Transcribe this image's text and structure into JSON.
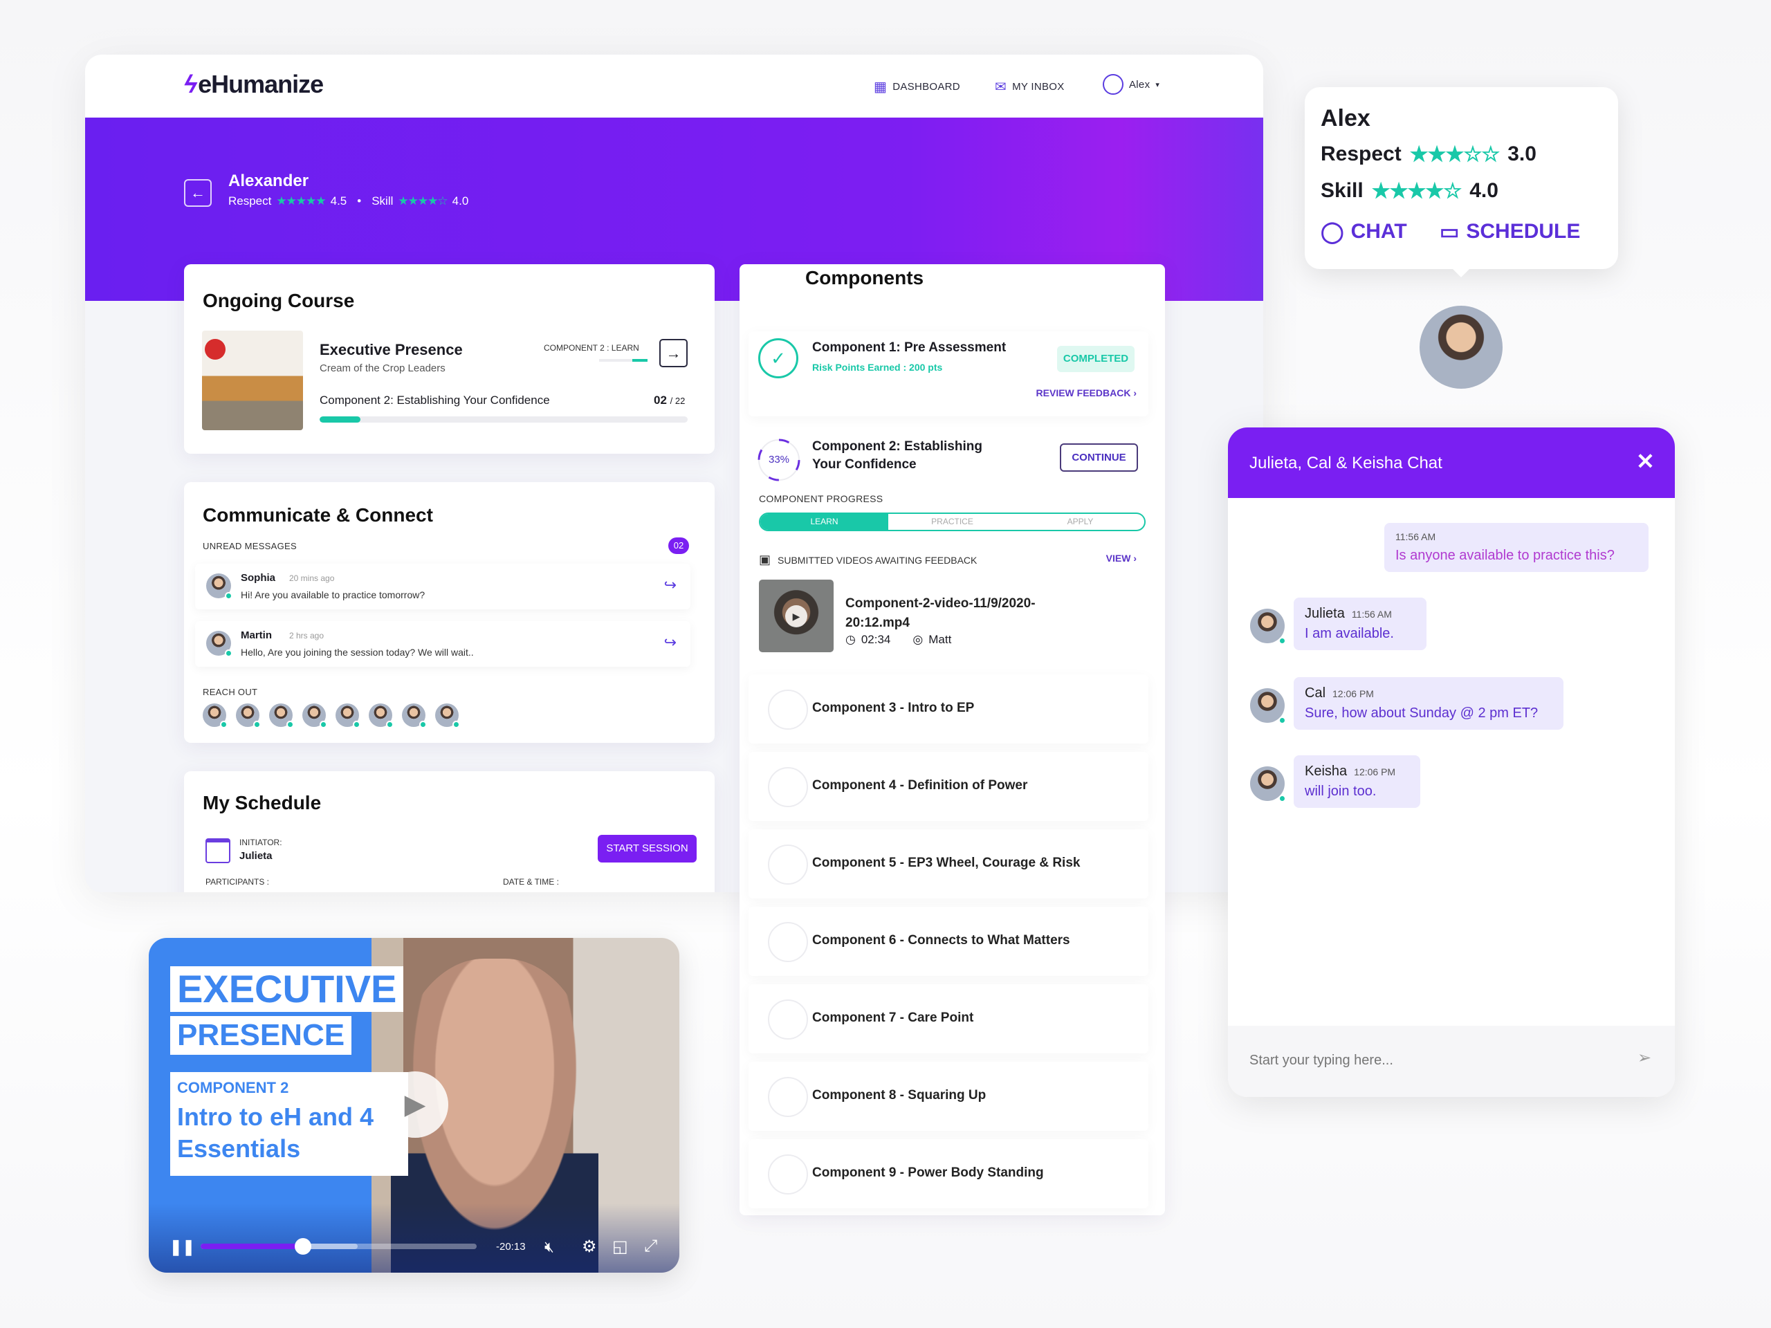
{
  "app": {
    "brand": "eHumanize",
    "accent": "#7a1ff2",
    "teal": "#19c8a8"
  },
  "nav": {
    "dashboard": "DASHBOARD",
    "inbox": "MY INBOX",
    "user": "Alex"
  },
  "profile": {
    "name": "Alexander",
    "respect_label": "Respect",
    "respect": 4.5,
    "respect_text": "4.5",
    "separator": "•",
    "skill_label": "Skill",
    "skill": 4.0,
    "skill_text": "4.0"
  },
  "ongoing": {
    "title": "Ongoing Course",
    "course": "Executive Presence",
    "subtitle": "Cream of the Crop Leaders",
    "stage": "COMPONENT 2 : LEARN",
    "current": "Component 2: Establishing Your Confidence",
    "count": "02",
    "total": "/ 22",
    "progress_pct": 11
  },
  "communicate": {
    "title": "Communicate & Connect",
    "unread_label": "UNREAD MESSAGES",
    "unread_count": "02",
    "messages": [
      {
        "name": "Sophia",
        "time": "20 mins ago",
        "text": "Hi! Are you available to practice tomorrow?"
      },
      {
        "name": "Martin",
        "time": "2 hrs ago",
        "text": "Hello, Are you joining the session today? We will wait.."
      }
    ],
    "reach_out_label": "REACH OUT",
    "reach_out_count": 8
  },
  "schedule": {
    "title": "My Schedule",
    "initiator_label": "INITIATOR:",
    "initiator": "Julieta",
    "start": "START SESSION",
    "participants_label": "PARTICIPANTS :",
    "datetime_label": "DATE & TIME :"
  },
  "components": {
    "title": "Components",
    "c1": {
      "title": "Component 1: Pre Assessment",
      "points": "Risk Points Earned : 200 pts",
      "status": "COMPLETED",
      "review": "REVIEW FEEDBACK ›"
    },
    "c2": {
      "title_1": "Component 2: Establishing",
      "title_2": "Your Confidence",
      "percent": "33%",
      "percent_value": 33,
      "continue": "CONTINUE",
      "progress_label": "COMPONENT PROGRESS",
      "stages": [
        "LEARN",
        "PRACTICE",
        "APPLY"
      ],
      "active_stage": "LEARN"
    },
    "videos": {
      "label": "SUBMITTED VIDEOS AWAITING FEEDBACK",
      "view": "VIEW ›",
      "file_1": "Component-2-video-11/9/2020-",
      "file_2": "20:12.mp4",
      "duration": "02:34",
      "reviewer": "Matt"
    },
    "list": [
      "Component 3 - Intro to EP",
      "Component 4 - Definition of Power",
      "Component 5 - EP3 Wheel, Courage & Risk",
      "Component 6 - Connects to What Matters",
      "Component 7 - Care Point",
      "Component 8 - Squaring Up",
      "Component 9 - Power Body Standing"
    ]
  },
  "popup": {
    "name": "Alex",
    "respect_label": "Respect",
    "respect": 3.0,
    "respect_text": "3.0",
    "skill_label": "Skill",
    "skill": 4.0,
    "skill_text": "4.0",
    "chat": "CHAT",
    "schedule": "SCHEDULE"
  },
  "chat": {
    "title": "Julieta, Cal & Keisha Chat",
    "own": {
      "time": "11:56 AM",
      "text": "Is anyone available to practice this?"
    },
    "messages": [
      {
        "name": "Julieta",
        "time": "11:56 AM",
        "text": "I am available."
      },
      {
        "name": "Cal",
        "time": "12:06 PM",
        "text": "Sure, how about Sunday @ 2 pm ET?"
      },
      {
        "name": "Keisha",
        "time": "12:06 PM",
        "text": "will join too."
      }
    ],
    "placeholder": "Start your typing here..."
  },
  "video": {
    "line1": "EXECUTIVE",
    "line2": "PRESENCE",
    "component": "COMPONENT 2",
    "title_1": "Intro to eH and 4",
    "title_2": "Essentials",
    "remaining": "-20:13",
    "played_pct": 37,
    "buffered_pct": 57
  }
}
